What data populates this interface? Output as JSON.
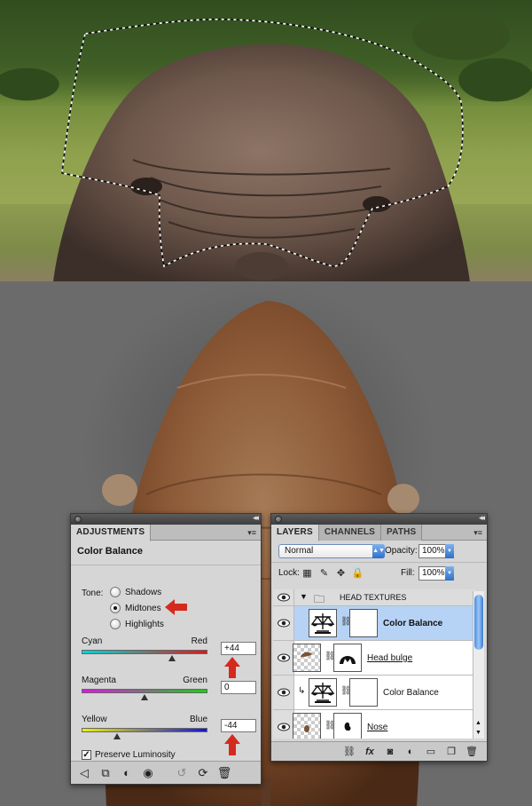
{
  "adjustments_panel": {
    "tab_label": "ADJUSTMENTS",
    "title": "Color Balance",
    "tone_label": "Tone:",
    "tone_options": [
      "Shadows",
      "Midtones",
      "Highlights"
    ],
    "selected_tone": "Midtones",
    "sliders": [
      {
        "left_label": "Cyan",
        "right_label": "Red",
        "value": "+44",
        "fraction": 0.72
      },
      {
        "left_label": "Magenta",
        "right_label": "Green",
        "value": "0",
        "fraction": 0.5
      },
      {
        "left_label": "Yellow",
        "right_label": "Blue",
        "value": "-44",
        "fraction": 0.28
      }
    ],
    "preserve_luminosity_label": "Preserve Luminosity",
    "preserve_luminosity_checked": true,
    "footer_icons": [
      "back-arrow-icon",
      "expand-view-icon",
      "clip-to-layer-icon",
      "visibility-eye-icon",
      "previous-state-icon",
      "reset-icon",
      "trash-icon"
    ]
  },
  "layers_panel": {
    "tabs": [
      "LAYERS",
      "CHANNELS",
      "PATHS"
    ],
    "blend_mode": "Normal",
    "opacity_label": "Opacity:",
    "opacity_value": "100%",
    "lock_label": "Lock:",
    "fill_label": "Fill:",
    "fill_value": "100%",
    "layers": [
      {
        "name": "HEAD TEXTURES",
        "type": "group"
      },
      {
        "name": "Color Balance",
        "type": "adjustment",
        "selected": true,
        "clipped": false
      },
      {
        "name": "Head bulge",
        "type": "pixel",
        "underlined": true
      },
      {
        "name": "Color Balance",
        "type": "adjustment",
        "selected": false,
        "clipped": true
      },
      {
        "name": "Nose",
        "type": "pixel",
        "underlined": true
      }
    ],
    "footer_icons": [
      "link-layers-icon",
      "fx-icon",
      "add-mask-icon",
      "new-adjustment-icon",
      "new-group-icon",
      "new-layer-icon",
      "trash-icon"
    ]
  },
  "colors": {
    "annotation_arrow": "#d42a1e",
    "selection_highlight": "#b6d2f5",
    "canvas_gray": "#6b6b6b"
  }
}
